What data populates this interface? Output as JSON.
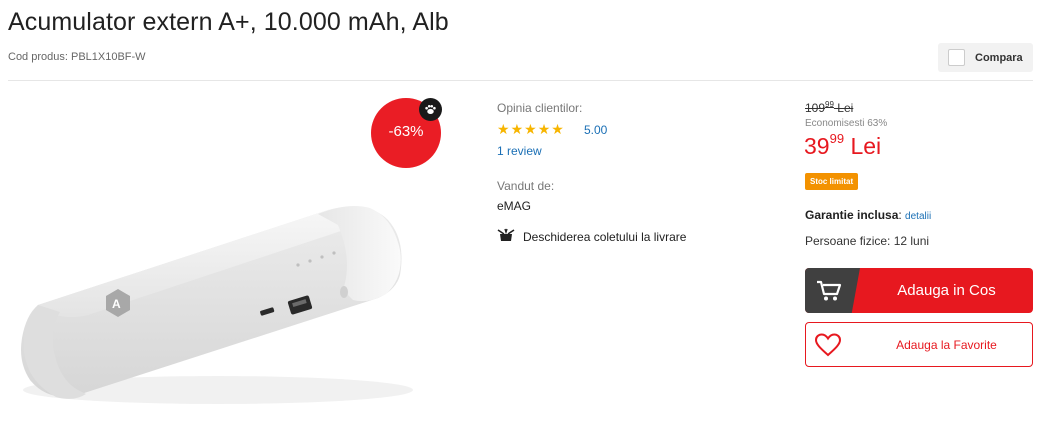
{
  "product": {
    "title": "Acumulator extern A+, 10.000 mAh, Alb",
    "code_label": "Cod produs: PBL1X10BF-W",
    "compare_label": "Compara",
    "discount_badge": "-63%"
  },
  "reviews": {
    "label": "Opinia clientilor:",
    "rating": "5.00",
    "stars": 5,
    "review_link": "1 review"
  },
  "seller": {
    "label": "Vandut de:",
    "name": "eMAG",
    "delivery_note": "Deschiderea coletului la livrare"
  },
  "price": {
    "old_main": "109",
    "old_cents": "99",
    "old_currency": " Lei",
    "saving": "Economisesti 63%",
    "new_main": "39",
    "new_cents": "99",
    "new_currency": " Lei",
    "stock_badge": "Stoc limitat"
  },
  "warranty": {
    "label": "Garantie inclusa",
    "separator": ": ",
    "link": "detalii",
    "persons": "Persoane fizice: 12 luni"
  },
  "actions": {
    "add_to_cart": "Adauga in Cos",
    "add_to_fav": "Adauga la Favorite"
  },
  "colors": {
    "brand_red": "#e7181f",
    "link_blue": "#1a6fb5",
    "star_gold": "#f7b500",
    "stock_orange": "#f39200"
  },
  "icons": {
    "compare_checkbox": "checkbox-icon",
    "paw": "paw-icon",
    "delivery": "package-open-icon",
    "cart": "cart-icon",
    "heart": "heart-icon"
  }
}
